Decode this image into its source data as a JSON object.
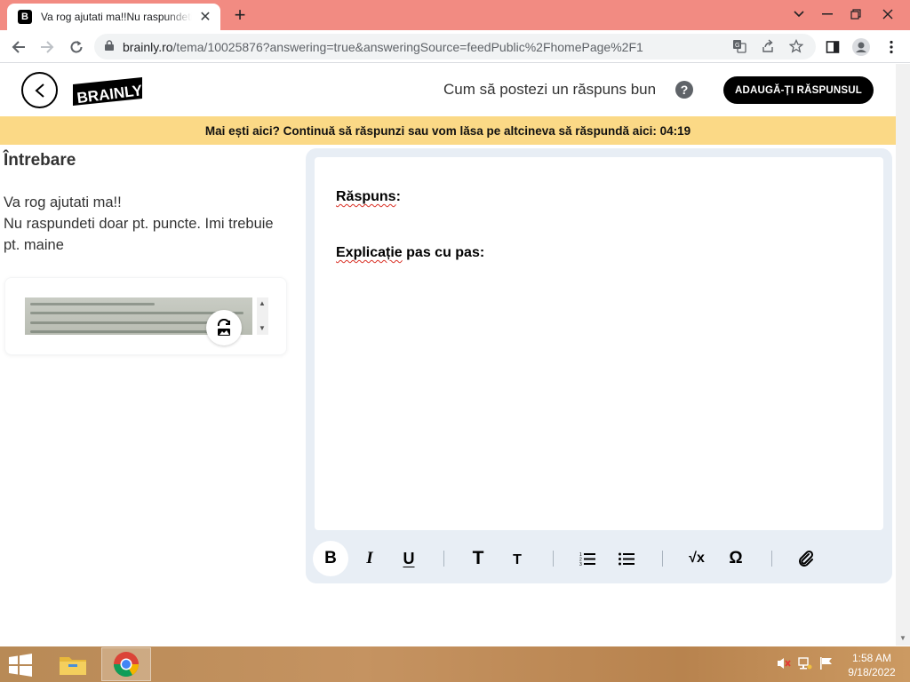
{
  "browser": {
    "tab": {
      "favicon": "B",
      "title": "Va rog ajutati ma!!Nu raspundeti doar pt. puncte",
      "close_glyph": "✕"
    },
    "new_tab_glyph": "+",
    "url": {
      "host": "brainly.ro",
      "path": "/tema/10025876?answering=true&answeringSource=feedPublic%2FhomePage%2F1"
    },
    "icons": [
      "back-arrow-icon",
      "forward-arrow-icon",
      "reload-icon",
      "lock-icon",
      "translate-icon",
      "share-icon",
      "star-icon",
      "sidebar-icon",
      "profile-icon",
      "menu-dots-icon"
    ]
  },
  "header": {
    "logo_text": "BRAINLY",
    "tips_link": "Cum să postezi un răspuns bun",
    "help_glyph": "?",
    "add_answer_label": "ADAUGĂ-ȚI RĂSPUNSUL"
  },
  "banner": {
    "text": "Mai ești aici? Continuă să răspunzi sau vom lăsa pe altcineva să răspundă aici: 04:19"
  },
  "question": {
    "heading": "Întrebare",
    "line1": "Va rog ajutati ma!!",
    "line2": "Nu raspundeti doar pt. puncte. Imi trebuie pt. maine"
  },
  "editor": {
    "answer_label": "Răspuns",
    "explanation_label": "Explicație",
    "explanation_rest": " pas cu pas:",
    "toolbar": [
      "bold-icon",
      "italic-icon",
      "underline-icon",
      "heading-large-icon",
      "heading-small-icon",
      "numbered-list-icon",
      "bullet-list-icon",
      "square-root-icon",
      "omega-icon",
      "attachment-icon"
    ],
    "bold_glyph": "B",
    "italic_glyph": "I",
    "underline_glyph": "U",
    "heading_large_glyph": "T",
    "heading_small_glyph": "T",
    "sqrt_glyph": "√x",
    "omega_glyph": "Ω"
  },
  "taskbar": {
    "time": "1:58 AM",
    "date": "9/18/2022",
    "icons": [
      "windows-start-icon",
      "file-explorer-icon",
      "chrome-icon",
      "volume-muted-icon",
      "network-icon",
      "flag-icon"
    ]
  },
  "colors": {
    "tab_strip": "#f28b82",
    "banner": "#fbd986",
    "editor_frame": "#e8eef5",
    "button_black": "#000000"
  }
}
